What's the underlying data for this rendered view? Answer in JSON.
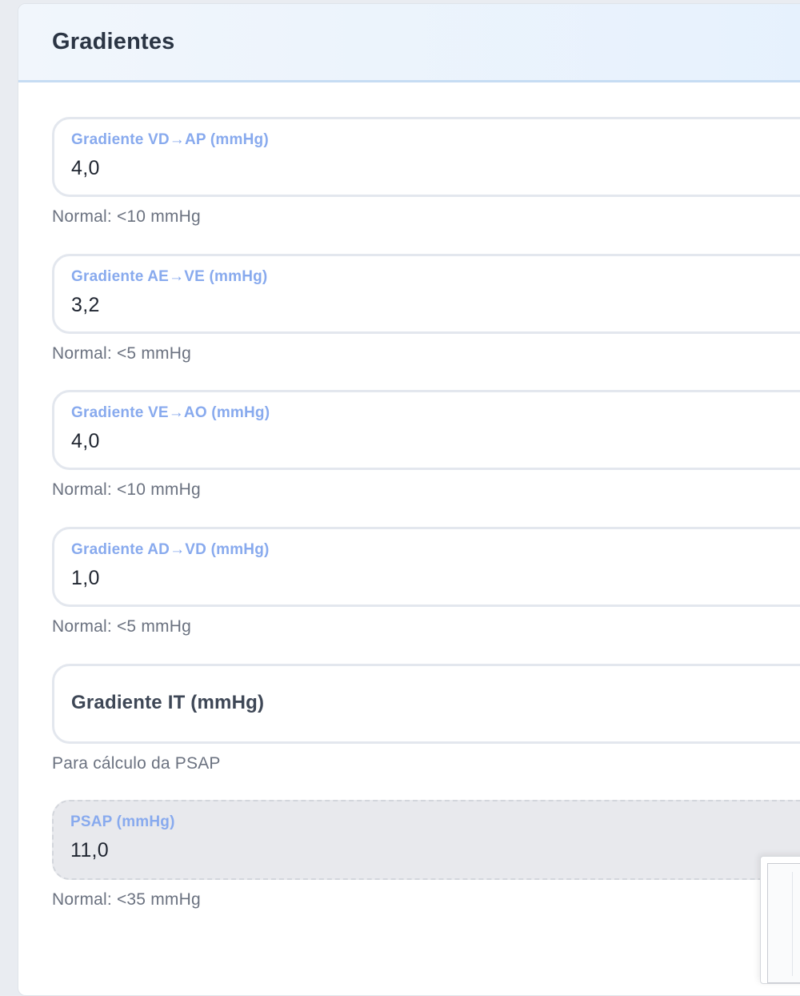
{
  "section": {
    "title": "Gradientes"
  },
  "fields": [
    {
      "label": "Gradiente VD→AP (mmHg)",
      "value": "4,0",
      "hint": "Normal: <10 mmHg"
    },
    {
      "label": "Gradiente AE→VE (mmHg)",
      "value": "3,2",
      "hint": "Normal: <5 mmHg"
    },
    {
      "label": "Gradiente VE→AO (mmHg)",
      "value": "4,0",
      "hint": "Normal: <10 mmHg"
    },
    {
      "label": "Gradiente AD→VD (mmHg)",
      "value": "1,0",
      "hint": "Normal: <5 mmHg"
    }
  ],
  "it_field": {
    "placeholder": "Gradiente IT (mmHg)",
    "hint": "Para cálculo da PSAP"
  },
  "psap_field": {
    "label": "PSAP (mmHg)",
    "value": "11,0",
    "hint": "Normal: <35 mmHg"
  }
}
